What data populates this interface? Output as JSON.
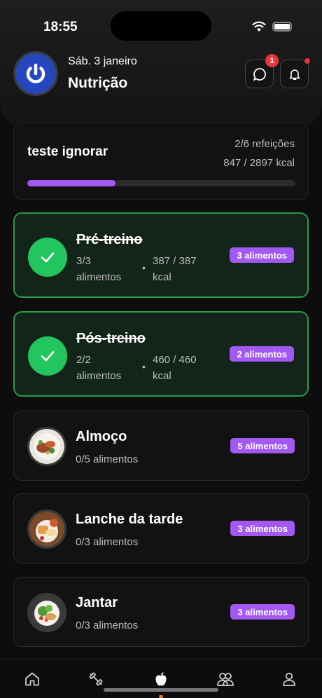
{
  "status": {
    "time": "18:55"
  },
  "header": {
    "date": "Sáb. 3 janeiro",
    "title": "Nutrição",
    "chat_badge": "1"
  },
  "summary": {
    "title": "teste ignorar",
    "meals": "2/6 refeições",
    "kcal": "847 / 2897 kcal",
    "progress": 0.33
  },
  "meals": [
    {
      "name": "Pré-treino",
      "done": true,
      "foods_line1": "3/3",
      "foods_line2": "alimentos",
      "dot": "•",
      "kcal_line1": "387 / 387",
      "kcal_line2": "kcal",
      "badge": "3 alimentos"
    },
    {
      "name": "Pós-treino",
      "done": true,
      "foods_line1": "2/2",
      "foods_line2": "alimentos",
      "dot": "•",
      "kcal_line1": "460 / 460",
      "kcal_line2": "kcal",
      "badge": "2 alimentos"
    },
    {
      "name": "Almoço",
      "done": false,
      "foods": "0/5 alimentos",
      "badge": "5 alimentos"
    },
    {
      "name": "Lanche da tarde",
      "done": false,
      "foods": "0/3 alimentos",
      "badge": "3 alimentos"
    },
    {
      "name": "Jantar",
      "done": false,
      "foods": "0/3 alimentos",
      "badge": "3 alimentos"
    }
  ],
  "tabs": [
    {
      "icon": "home-icon"
    },
    {
      "icon": "dumbbell-icon"
    },
    {
      "icon": "apple-icon",
      "active": true
    },
    {
      "icon": "community-icon"
    },
    {
      "icon": "profile-icon"
    }
  ],
  "colors": {
    "accent": "#a259f2",
    "success": "#22c55e",
    "alert": "#e5383b",
    "tab_active": "#f07b2a"
  }
}
